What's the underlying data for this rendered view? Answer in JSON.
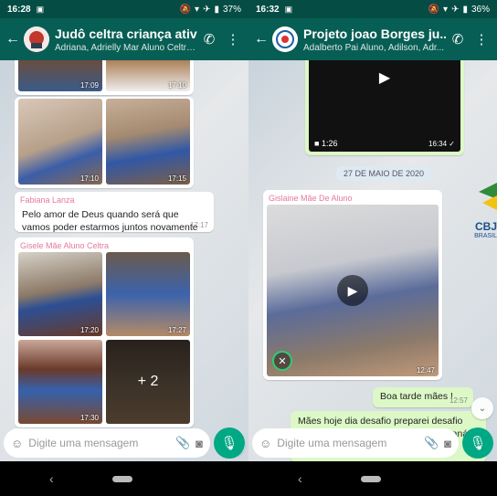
{
  "left": {
    "status": {
      "time": "16:28",
      "battery": "37%"
    },
    "header": {
      "title": "Judô celtra criança ativa",
      "subtitle": "Adriana, Adrielly Mar Aluno Celtra..."
    },
    "top_photos": [
      {
        "time": "17:09"
      },
      {
        "time": "17:10"
      }
    ],
    "photo_grid_1": [
      {
        "time": ""
      },
      {
        "time": ""
      },
      {
        "time": "17:10"
      },
      {
        "time": "17:15"
      }
    ],
    "text_msg": {
      "sender": "Fabiana Lanza",
      "text": "Pelo amor de Deus quando será que vamos poder estarmos juntos novamente",
      "time": "17:17"
    },
    "photo_grid_2": {
      "sender": "Gisele Mãe Aluno Celtra",
      "items": [
        {
          "time": "17:20"
        },
        {
          "time": "17:27"
        },
        {
          "time": "17:30"
        },
        {
          "time": ""
        }
      ],
      "more_label": "+ 2"
    },
    "input_placeholder": "Digite uma mensagem",
    "colors": {
      "header": "#075e54",
      "statusbar": "#054d44",
      "accent": "#00a884"
    }
  },
  "right": {
    "status": {
      "time": "16:32",
      "battery": "36%"
    },
    "header": {
      "title": "Projeto joao Borges ju...",
      "subtitle": "Adalberto Pai Aluno, Adilson, Adr..."
    },
    "top_video": {
      "duration": "1:26",
      "time": "16:34",
      "check": "✓"
    },
    "date_pill": "27 DE MAIO DE 2020",
    "video_msg": {
      "sender": "Gislaine Mãe De Aluno",
      "time": "12:47"
    },
    "out_msg_1": {
      "text": "Boa tarde mães !",
      "time": "12:57"
    },
    "out_msg_2": {
      "text": "Mães hoje dia desafio preparei desafio com professor Robson direto do Paraná para"
    },
    "input_placeholder": "Digite uma mensagem",
    "logo_text": "CBJ",
    "logo_sub": "BRASIL"
  }
}
